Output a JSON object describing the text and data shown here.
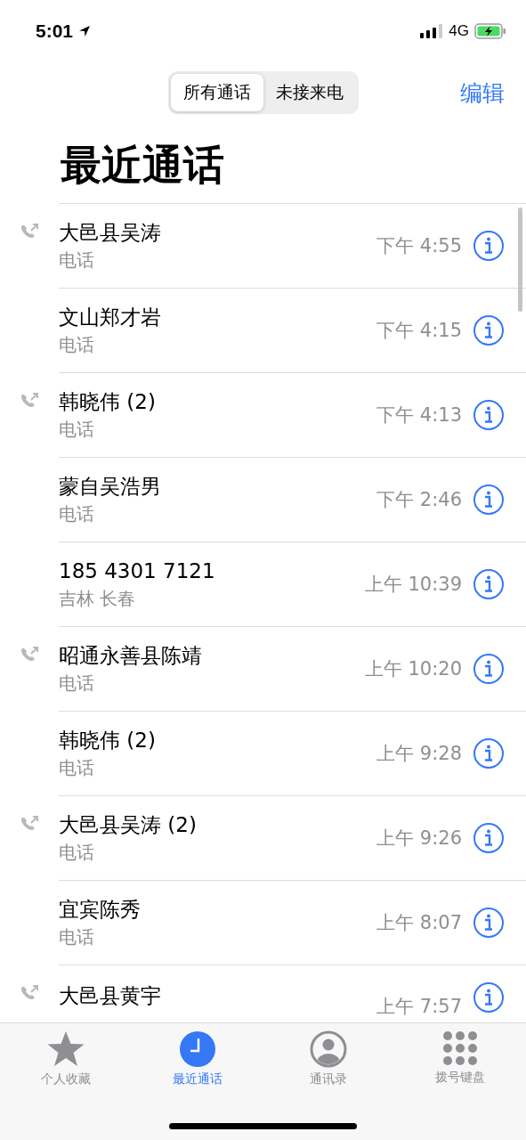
{
  "status_bar": {
    "time": "5:01",
    "network": "4G"
  },
  "segments": [
    {
      "label": "所有通话",
      "selected": true
    },
    {
      "label": "未接来电",
      "selected": false
    }
  ],
  "edit_button": "编辑",
  "title": "最近通话",
  "calls": [
    {
      "name": "大邑县吴涛",
      "subtitle": "电话",
      "time": "下午 4:55",
      "outgoing": true
    },
    {
      "name": "文山郑才岩",
      "subtitle": "电话",
      "time": "下午 4:15",
      "outgoing": false
    },
    {
      "name": "韩晓伟 (2)",
      "subtitle": "电话",
      "time": "下午 4:13",
      "outgoing": true
    },
    {
      "name": "蒙自吴浩男",
      "subtitle": "电话",
      "time": "下午 2:46",
      "outgoing": false
    },
    {
      "name": "185 4301 7121",
      "subtitle": "吉林 长春",
      "time": "上午 10:39",
      "outgoing": false
    },
    {
      "name": "昭通永善县陈靖",
      "subtitle": "电话",
      "time": "上午 10:20",
      "outgoing": true
    },
    {
      "name": "韩晓伟 (2)",
      "subtitle": "电话",
      "time": "上午 9:28",
      "outgoing": false
    },
    {
      "name": "大邑县吴涛 (2)",
      "subtitle": "电话",
      "time": "上午 9:26",
      "outgoing": true
    },
    {
      "name": "宜宾陈秀",
      "subtitle": "电话",
      "time": "上午 8:07",
      "outgoing": false
    },
    {
      "name": "大邑县黄宇",
      "time": "上午 7:57",
      "outgoing": true
    }
  ],
  "tab_bar": [
    {
      "label": "个人收藏",
      "kind": "star",
      "selected": false
    },
    {
      "label": "最近通话",
      "kind": "clock",
      "selected": true
    },
    {
      "label": "通讯录",
      "kind": "person",
      "selected": false
    },
    {
      "label": "拨号键盘",
      "kind": "keypad",
      "selected": false
    }
  ]
}
